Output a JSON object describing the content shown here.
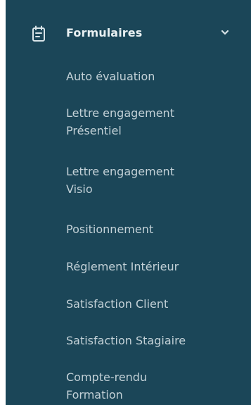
{
  "sidebar": {
    "group": {
      "title": "Formulaires",
      "icon": "form-icon",
      "expand_icon": "chevron-down-icon"
    },
    "items": [
      {
        "lines": [
          "Auto évaluation"
        ]
      },
      {
        "lines": [
          "Lettre engagement",
          "Présentiel"
        ]
      },
      {
        "lines": [
          "Lettre engagement",
          "Visio"
        ]
      },
      {
        "lines": [
          "Positionnement"
        ]
      },
      {
        "lines": [
          "Réglement Intérieur"
        ]
      },
      {
        "lines": [
          "Satisfaction Client"
        ]
      },
      {
        "lines": [
          "Satisfaction Stagiaire"
        ]
      },
      {
        "lines": [
          "Compte-rendu",
          "Formation"
        ]
      }
    ]
  }
}
